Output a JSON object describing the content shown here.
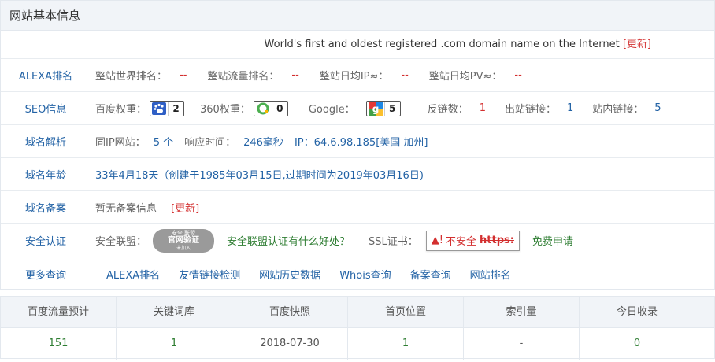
{
  "panel_title": "网站基本信息",
  "description": "World's first and oldest registered .com domain name on the Internet",
  "update_label": "[更新]",
  "alexa": {
    "label": "ALEXA排名",
    "items": [
      {
        "name": "整站世界排名：",
        "value": "--"
      },
      {
        "name": "整站流量排名：",
        "value": "--"
      },
      {
        "name": "整站日均IP≈：",
        "value": "--"
      },
      {
        "name": "整站日均PV≈：",
        "value": "--"
      }
    ]
  },
  "seo": {
    "label": "SEO信息",
    "baidu_label": "百度权重：",
    "baidu_value": "2",
    "so360_label": "360权重：",
    "so360_value": "0",
    "google_label": "Google：",
    "google_value": "5",
    "backlinks_label": "反链数：",
    "backlinks_value": "1",
    "outbound_label": "出站链接：",
    "outbound_value": "1",
    "internal_label": "站内链接：",
    "internal_value": "5"
  },
  "dns": {
    "label": "域名解析",
    "same_ip_label": "同IP网站：",
    "same_ip_value": "5 个",
    "response_label": "响应时间：",
    "response_value": "246毫秒",
    "ip_label": "IP：",
    "ip_value": "64.6.98.185[美国 加州]"
  },
  "age": {
    "label": "域名年龄",
    "value": "33年4月18天（创建于1985年03月15日,过期时间为2019年03月16日)"
  },
  "icp": {
    "label": "域名备案",
    "value": "暂无备案信息",
    "update_label": "[更新]"
  },
  "security": {
    "label": "安全认证",
    "union_label": "安全联盟：",
    "seal_top": "安全 联盟",
    "seal_mid": "官网验证",
    "seal_bot": "未加入",
    "union_link": "安全联盟认证有什么好处？",
    "ssl_label": "SSL证书：",
    "ssl_status": "不安全",
    "ssl_https": "https:",
    "ssl_apply": "免费申请"
  },
  "more": {
    "label": "更多查询",
    "links": [
      "ALEXA排名",
      "友情链接检测",
      "网站历史数据",
      "Whois查询",
      "备案查询",
      "网站排名"
    ]
  },
  "stats": {
    "headers": [
      "百度流量预计",
      "关键词库",
      "百度快照",
      "首页位置",
      "索引量",
      "今日收录"
    ],
    "values": [
      "151",
      "1",
      "2018-07-30",
      "1",
      "-",
      "0"
    ]
  },
  "colors": {
    "label_blue": "#2262a5",
    "value_red": "#d32f2f",
    "link_green": "#2e7d32",
    "header_bg": "#f1f4f8"
  }
}
